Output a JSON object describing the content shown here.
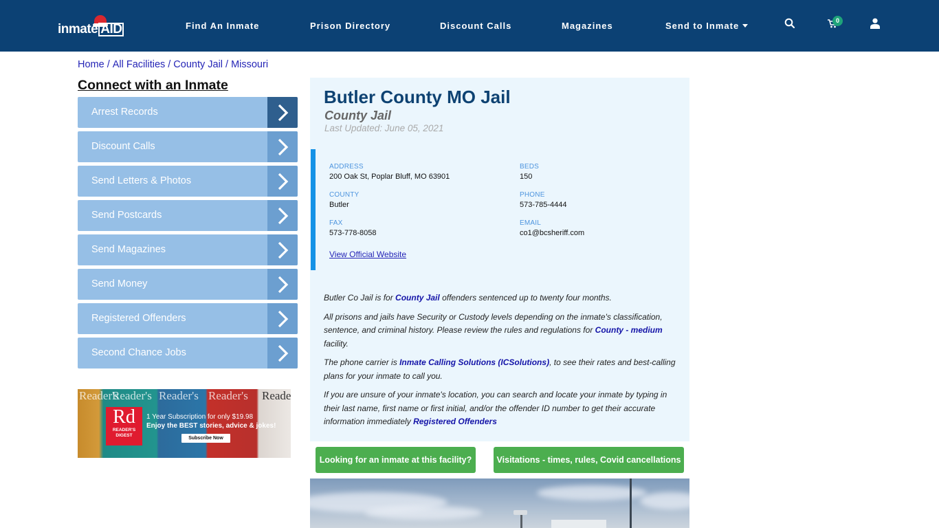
{
  "header": {
    "logo_text": "inmate",
    "logo_accent": "AID",
    "nav": [
      {
        "label": "Find An Inmate"
      },
      {
        "label": "Prison Directory"
      },
      {
        "label": "Discount Calls"
      },
      {
        "label": "Magazines"
      },
      {
        "label": "Send to Inmate",
        "has_dropdown": true
      }
    ],
    "icons": [
      "search-icon",
      "cart-icon",
      "user-icon"
    ],
    "cart_count": "0"
  },
  "breadcrumb": [
    {
      "label": "Home"
    },
    {
      "label": "All Facilities"
    },
    {
      "label": "County Jail"
    },
    {
      "label": "Missouri"
    }
  ],
  "breadcrumb_separator": "/",
  "sidebar": {
    "title": "Connect with an Inmate",
    "items": [
      {
        "label": "Arrest Records",
        "active": true
      },
      {
        "label": "Discount Calls"
      },
      {
        "label": "Send Letters & Photos"
      },
      {
        "label": "Send Postcards"
      },
      {
        "label": "Send Magazines"
      },
      {
        "label": "Send Money"
      },
      {
        "label": "Registered Offenders"
      },
      {
        "label": "Second Chance Jobs"
      }
    ]
  },
  "ad": {
    "brand_big": "Rd",
    "brand_line1": "READER'S",
    "brand_line2": "DIGEST",
    "cover_text": "Reader's",
    "line1": "1 Year Subscription for only $19.98",
    "line2": "Enjoy the BEST stories, advice & jokes!",
    "cta": "Subscribe Now"
  },
  "facility": {
    "name": "Butler County MO Jail",
    "type": "County Jail",
    "last_updated": "Last Updated: June 05, 2021",
    "fields": {
      "address": {
        "label": "ADDRESS",
        "value": "200 Oak St, Poplar Bluff, MO 63901"
      },
      "beds": {
        "label": "BEDS",
        "value": "150"
      },
      "county": {
        "label": "COUNTY",
        "value": "Butler"
      },
      "phone": {
        "label": "PHONE",
        "value": "573-785-4444"
      },
      "fax": {
        "label": "FAX",
        "value": "573-778-8058"
      },
      "email": {
        "label": "EMAIL",
        "value": "co1@bcsheriff.com"
      }
    },
    "website_link": "View Official Website"
  },
  "description": {
    "p1": {
      "before": "Butler Co Jail is for ",
      "link": "County Jail",
      "after": " offenders sentenced up to twenty four months."
    },
    "p2": {
      "before": "All prisons and jails have Security or Custody levels depending on the inmate's classification, sentence, and criminal history. Please review the rules and regulations for ",
      "link": "County - medium",
      "after": " facility."
    },
    "p3": {
      "before": "The phone carrier is ",
      "link": "Inmate Calling Solutions (ICSolutions)",
      "after": ", to see their rates and best-calling plans for your inmate to call you."
    },
    "p4": {
      "before": "If you are unsure of your inmate's location, you can search and locate your inmate by typing in their last name, first name or first initial, and/or the offender ID number to get their accurate information immediately ",
      "link": "Registered Offenders",
      "after": ""
    }
  },
  "actions": {
    "find_inmate": "Looking for an inmate at this facility?",
    "visitations": "Visitations - times, rules, Covid cancellations"
  },
  "colors": {
    "header_bg": "#0c4174",
    "sidebar_item": "#96bfe6",
    "sidebar_arrow": "#6c9fd0",
    "sidebar_arrow_active": "#2f5f8e",
    "card_bg": "#ebf6fd",
    "accent_bar": "#1592e6",
    "button_green": "#4cae4f",
    "title": "#0e4272"
  }
}
